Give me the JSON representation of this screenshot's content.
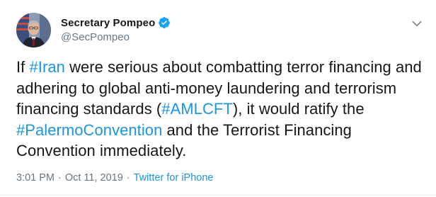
{
  "author": {
    "display_name": "Secretary Pompeo",
    "handle": "@SecPompeo",
    "verified": true
  },
  "tweet": {
    "text_1": "If ",
    "hashtag_1": "#Iran",
    "text_2": " were serious about combatting terror financing and adhering to global anti-money laundering and terrorism financing standards (",
    "hashtag_2": "#AMLCFT",
    "text_3": "), it would ratify the ",
    "hashtag_3": "#PalermoConvention",
    "text_4": " and the Terrorist Financing Convention immediately."
  },
  "meta": {
    "time": "3:01 PM",
    "separator": "·",
    "date": "Oct 11, 2019",
    "source": "Twitter for iPhone"
  },
  "colors": {
    "link": "#1b95e0",
    "secondary_text": "#657786",
    "primary_text": "#14171a",
    "verified_badge": "#1da1f2"
  },
  "icons": {
    "verified": "verified-badge-icon",
    "menu": "chevron-down-icon"
  }
}
